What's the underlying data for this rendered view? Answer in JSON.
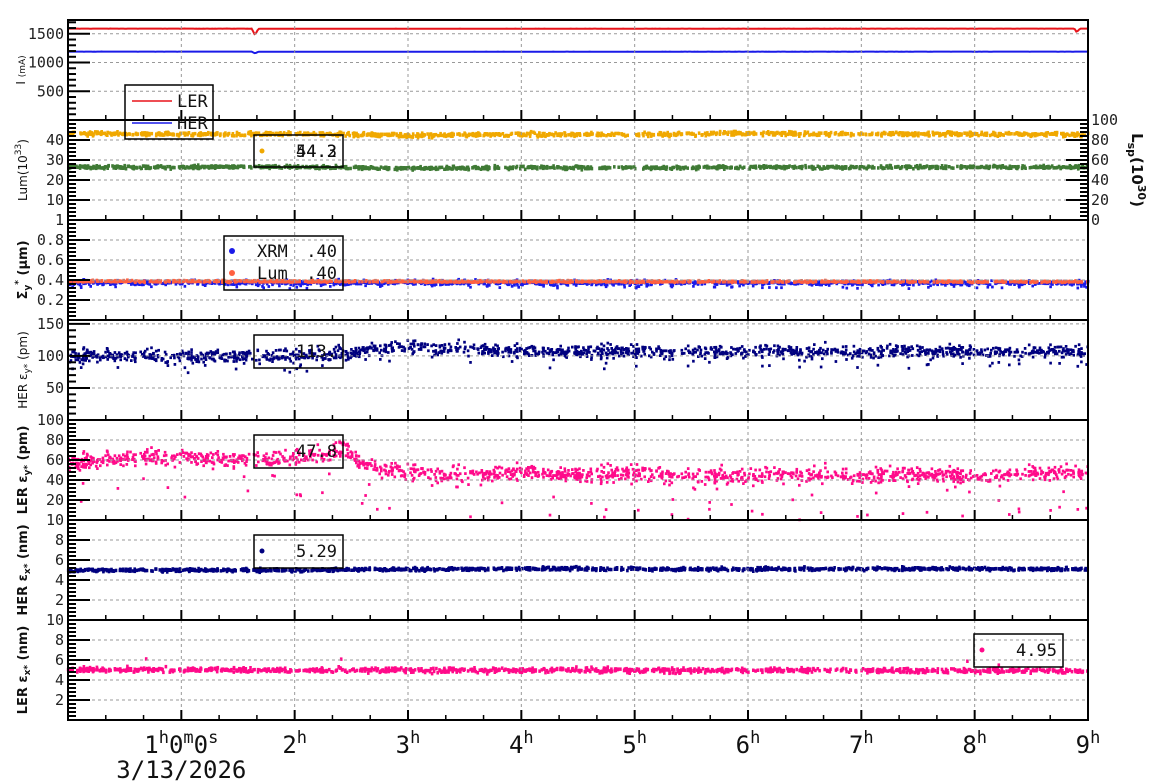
{
  "chart_data": {
    "type": "scatter",
    "title": "",
    "xlabel": "",
    "xlim": [
      0,
      9
    ],
    "x_unit": "hours",
    "x_tick_labels": [
      {
        "h": 1,
        "base": "1",
        "sups": [
          "h",
          "m",
          "s"
        ],
        "parts": [
          "1",
          "0",
          "0"
        ]
      },
      {
        "h": 2,
        "base": "2",
        "sups": [
          "h"
        ]
      },
      {
        "h": 3,
        "base": "3",
        "sups": [
          "h"
        ]
      },
      {
        "h": 4,
        "base": "4",
        "sups": [
          "h"
        ]
      },
      {
        "h": 5,
        "base": "5",
        "sups": [
          "h"
        ]
      },
      {
        "h": 6,
        "base": "6",
        "sups": [
          "h"
        ]
      },
      {
        "h": 7,
        "base": "7",
        "sups": [
          "h"
        ]
      },
      {
        "h": 8,
        "base": "8",
        "sups": [
          "h"
        ]
      },
      {
        "h": 9,
        "base": "9",
        "sups": [
          "h"
        ]
      }
    ],
    "date": "3/13/2026",
    "grid": true,
    "panels": [
      {
        "ylabel": {
          "main": "I ",
          "unit": "(mA)"
        },
        "bold": false,
        "ylim": [
          0,
          1740
        ],
        "yticks": [
          500,
          1000,
          1500
        ],
        "ytick_labels": [
          "500",
          "1000",
          "1500"
        ],
        "legend": {
          "type": "lines",
          "entries": [
            "LER",
            "HER"
          ]
        },
        "series": [
          {
            "name": "LER",
            "color": "#e8141a",
            "mode": "line",
            "trend": [
              [
                0,
                1590
              ],
              [
                1.62,
                1590
              ],
              [
                1.65,
                1480
              ],
              [
                1.68,
                1588
              ],
              [
                8.88,
                1590
              ],
              [
                8.9,
                1530
              ],
              [
                8.93,
                1590
              ],
              [
                9,
                1590
              ]
            ],
            "spread": 2
          },
          {
            "name": "HER",
            "color": "#1a1ae8",
            "mode": "line",
            "trend": [
              [
                0,
                1190
              ],
              [
                1.62,
                1190
              ],
              [
                1.65,
                1160
              ],
              [
                1.68,
                1188
              ],
              [
                9,
                1190
              ]
            ],
            "spread": 1.5
          }
        ]
      },
      {
        "ylabel": {
          "main": "Lum(10",
          "sup": "33",
          "tail": ")"
        },
        "bold": false,
        "ylim": [
          0,
          50
        ],
        "yticks": [
          10,
          20,
          30,
          40
        ],
        "ytick_labels": [
          "10",
          "20",
          "30",
          "40"
        ],
        "right_axis": {
          "label": "L",
          "sub": "sp",
          "mid": "(10",
          "sup": "30",
          "tail": ")",
          "ylim": [
            0,
            100
          ],
          "ticks": [
            "0",
            "20",
            "40",
            "60",
            "80",
            "100"
          ]
        },
        "legend": {
          "type": "overlap",
          "values": [
            "54.2",
            "44.3"
          ],
          "color": "#f0a800"
        },
        "series": [
          {
            "name": "Lum",
            "color": "#f0a800",
            "mode": "band",
            "trend": [
              [
                0,
                43.3
              ],
              [
                1,
                43
              ],
              [
                2,
                43.2
              ],
              [
                3,
                42.5
              ],
              [
                4,
                43
              ],
              [
                5,
                42.8
              ],
              [
                6,
                43.5
              ],
              [
                7,
                43
              ],
              [
                8,
                43.2
              ],
              [
                9,
                42.8
              ]
            ],
            "spread": 0.5
          },
          {
            "name": "Lsp",
            "color": "#3f7a35",
            "mode": "band",
            "trend": [
              [
                0,
                26.5
              ],
              [
                1,
                26.5
              ],
              [
                2,
                26.8
              ],
              [
                3,
                26
              ],
              [
                4,
                26.3
              ],
              [
                5,
                26.2
              ],
              [
                6,
                26.5
              ],
              [
                7,
                26.4
              ],
              [
                8,
                26.6
              ],
              [
                9,
                26.5
              ]
            ],
            "spread": 0.4
          }
        ]
      },
      {
        "ylabel": {
          "main": "Σ",
          "sub": "y",
          "sup": "*",
          "tail": " (μm)"
        },
        "bold": true,
        "ylim": [
          0,
          1
        ],
        "yticks": [
          0.2,
          0.4,
          0.6,
          0.8,
          1
        ],
        "ytick_labels": [
          "0.2",
          "0.4",
          "0.6",
          "0.8",
          "1"
        ],
        "legend": {
          "type": "entries",
          "entries": [
            {
              "label": "XRM",
              "value": ".40",
              "color": "#1a1ae8"
            },
            {
              "label": "Lum",
              "value": ".40",
              "color": "#ff6040"
            }
          ]
        },
        "series": [
          {
            "name": "XRM",
            "color": "#1a1ae8",
            "mode": "scatter",
            "trend": [
              [
                0,
                0.375
              ],
              [
                9,
                0.37
              ]
            ],
            "spread": 0.012,
            "outlier_rate": 0.06,
            "outlier_offset": -0.04
          },
          {
            "name": "Lum",
            "color": "#ff6040",
            "mode": "band",
            "trend": [
              [
                0,
                0.39
              ],
              [
                9,
                0.385
              ]
            ],
            "spread": 0.004
          }
        ]
      },
      {
        "ylabel": {
          "main": "HER ε",
          "sub": "y*",
          "tail": " (pm)"
        },
        "bold": false,
        "ylim": [
          0,
          156
        ],
        "yticks": [
          50,
          100,
          150
        ],
        "ytick_labels": [
          "50",
          "100",
          "150"
        ],
        "legend": {
          "type": "value",
          "value": "113."
        },
        "series": [
          {
            "name": "HER emittance y",
            "color": "#00007f",
            "mode": "scatter",
            "trend": [
              [
                0,
                100
              ],
              [
                0.5,
                101
              ],
              [
                1,
                99
              ],
              [
                1.5,
                100
              ],
              [
                2,
                101
              ],
              [
                2.5,
                103
              ],
              [
                2.7,
                112
              ],
              [
                3,
                113
              ],
              [
                3.5,
                111
              ],
              [
                4,
                107
              ],
              [
                4.5,
                106
              ],
              [
                5,
                107
              ],
              [
                6,
                106
              ],
              [
                7,
                106
              ],
              [
                8,
                107
              ],
              [
                9,
                106
              ]
            ],
            "spread": 5,
            "outlier_rate": 0.05,
            "outlier_offset": -18
          }
        ]
      },
      {
        "ylabel": {
          "main": "LER ε",
          "sub": "y*",
          "tail": " (pm)"
        },
        "bold": true,
        "ylim": [
          0,
          100
        ],
        "yticks": [
          20,
          40,
          60,
          80,
          100
        ],
        "ytick_labels": [
          "20",
          "40",
          "60",
          "80",
          "100"
        ],
        "legend": {
          "type": "value",
          "value": "47.8"
        },
        "series": [
          {
            "name": "LER emittance y",
            "color": "#ff0a8a",
            "mode": "scatter",
            "trend": [
              [
                0,
                57
              ],
              [
                0.3,
                60
              ],
              [
                0.6,
                62
              ],
              [
                1,
                63
              ],
              [
                1.3,
                61
              ],
              [
                1.6,
                60
              ],
              [
                2,
                62
              ],
              [
                2.3,
                66
              ],
              [
                2.45,
                72
              ],
              [
                2.6,
                55
              ],
              [
                3,
                47
              ],
              [
                3.5,
                44
              ],
              [
                4,
                48
              ],
              [
                4.5,
                44
              ],
              [
                5,
                47
              ],
              [
                5.5,
                44
              ],
              [
                6,
                44
              ],
              [
                6.5,
                45
              ],
              [
                7,
                44
              ],
              [
                7.5,
                45
              ],
              [
                8,
                44
              ],
              [
                8.5,
                47
              ],
              [
                9,
                47
              ]
            ],
            "spread": 4,
            "outlier_rate": 0.04,
            "outlier_offset": -35
          }
        ]
      },
      {
        "ylabel": {
          "main": "HER ε",
          "sub": "x*",
          "tail": " (nm)"
        },
        "bold": true,
        "ylim": [
          0,
          10
        ],
        "yticks": [
          2,
          4,
          6,
          8,
          10
        ],
        "ytick_labels": [
          "2",
          "4",
          "6",
          "8",
          "10"
        ],
        "legend": {
          "type": "dot-value",
          "value": "5.29",
          "color": "#00007f"
        },
        "series": [
          {
            "name": "HER emittance x",
            "color": "#00007f",
            "mode": "band",
            "trend": [
              [
                0,
                5.0
              ],
              [
                2,
                5.0
              ],
              [
                3,
                5.1
              ],
              [
                4,
                5.15
              ],
              [
                6,
                5.1
              ],
              [
                8,
                5.15
              ],
              [
                9,
                5.1
              ]
            ],
            "spread": 0.08
          }
        ]
      },
      {
        "ylabel": {
          "main": "LER ε",
          "sub": "x*",
          "tail": " (nm)"
        },
        "bold": true,
        "ylim": [
          0,
          10
        ],
        "yticks": [
          2,
          4,
          6,
          8,
          10
        ],
        "ytick_labels": [
          "2",
          "4",
          "6",
          "8",
          "10"
        ],
        "legend": {
          "type": "dot-value",
          "value": "4.95",
          "color": "#ff0a8a"
        },
        "series": [
          {
            "name": "LER emittance x",
            "color": "#ff0a8a",
            "mode": "band",
            "trend": [
              [
                0,
                5.05
              ],
              [
                3,
                5.0
              ],
              [
                6,
                5.0
              ],
              [
                9,
                4.95
              ]
            ],
            "spread": 0.12,
            "outlier_rate": 0.004,
            "outlier_offset": 1.2
          }
        ]
      }
    ]
  }
}
